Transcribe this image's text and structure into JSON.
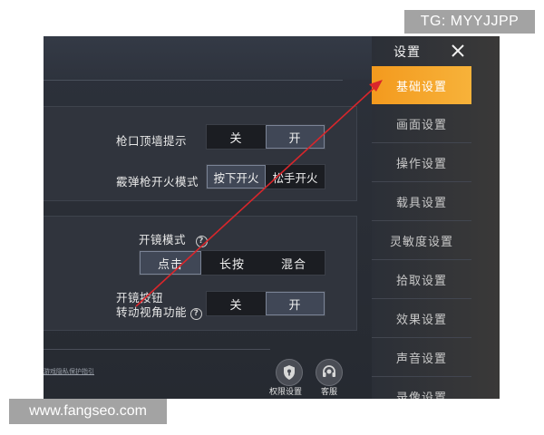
{
  "watermarks": {
    "top_right": "TG: MYYJJPP",
    "bottom_left": "www.fangseo.com"
  },
  "colors": {
    "accent": "#f5a623",
    "annotation_arrow": "#d9262b",
    "panel_bg": "#30343d",
    "sidebar_bg": "#2b2f37"
  },
  "sidebar": {
    "title": "设置",
    "close_icon": "close-icon",
    "items": [
      {
        "label": "基础设置",
        "active": true
      },
      {
        "label": "画面设置",
        "active": false
      },
      {
        "label": "操作设置",
        "active": false
      },
      {
        "label": "载具设置",
        "active": false
      },
      {
        "label": "灵敏度设置",
        "active": false
      },
      {
        "label": "拾取设置",
        "active": false
      },
      {
        "label": "效果设置",
        "active": false
      },
      {
        "label": "声音设置",
        "active": false
      },
      {
        "label": "录像设置",
        "active": false
      }
    ]
  },
  "settings": {
    "muzzle_wall_hint": {
      "label": "枪口顶墙提示",
      "options": [
        "关",
        "开"
      ],
      "selected": "开"
    },
    "shotgun_fire_mode": {
      "label": "霰弹枪开火模式",
      "options": [
        "按下开火",
        "松手开火"
      ],
      "selected": "按下开火"
    },
    "scope_mode": {
      "label": "开镜模式",
      "help_icon": "help-icon",
      "options": [
        "点击",
        "长按",
        "混合"
      ],
      "selected": "点击"
    },
    "scope_button_turn": {
      "label_line1": "开镜按钮",
      "label_line2": "转动视角功能",
      "help_icon": "help-icon",
      "options": [
        "关",
        "开"
      ],
      "selected": "开"
    }
  },
  "footer": {
    "privacy_link": "游戏隐私保护指引",
    "permission_button": {
      "icon": "shield-icon",
      "label": "权限设置"
    },
    "support_button": {
      "icon": "headset-icon",
      "label": "客服"
    }
  }
}
